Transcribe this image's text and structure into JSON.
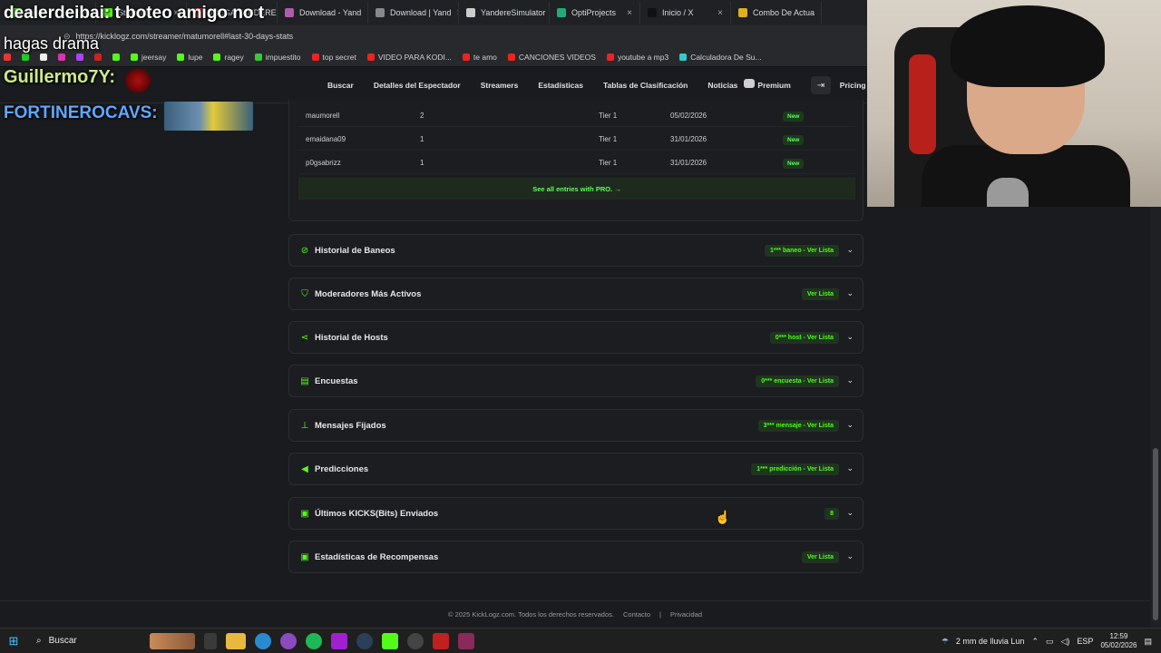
{
  "browser": {
    "tabs": [
      {
        "label": "Kick",
        "color": "#53fc18"
      },
      {
        "label": "Streamer",
        "color": "#53fc18"
      },
      {
        "label": "JUEGA YANDERE",
        "color": "#cc3333"
      },
      {
        "label": "Download - Yand",
        "color": "#b05ab0"
      },
      {
        "label": "Download | Yand",
        "color": "#888"
      },
      {
        "label": "YandereSimulator",
        "color": "#ccc"
      },
      {
        "label": "OptiProjects",
        "color": "#2a7"
      },
      {
        "label": "Inicio / X",
        "color": "#111"
      },
      {
        "label": "Combo De Actua",
        "color": "#e0b020"
      }
    ],
    "url": "https://kicklogz.com/streamer/matumorell#last-30-days-stats",
    "bookmarks": [
      {
        "label": "",
        "color": "#e33"
      },
      {
        "label": "",
        "color": "#2c2"
      },
      {
        "label": "",
        "color": "#eee"
      },
      {
        "label": "",
        "color": "#d3a"
      },
      {
        "label": "",
        "color": "#a4f"
      },
      {
        "label": "",
        "color": "#c22"
      },
      {
        "label": "",
        "color": "#53fc18"
      },
      {
        "label": "jeersay",
        "color": "#53fc18"
      },
      {
        "label": "lupe",
        "color": "#53fc18"
      },
      {
        "label": "ragey",
        "color": "#53fc18"
      },
      {
        "label": "impuestito",
        "color": "#3c3"
      },
      {
        "label": "top secret",
        "color": "#e22"
      },
      {
        "label": "VIDEO PARA KODI...",
        "color": "#e22"
      },
      {
        "label": "te amo",
        "color": "#e22"
      },
      {
        "label": "CANCIONES VIDEOS",
        "color": "#e22"
      },
      {
        "label": "youtube a mp3",
        "color": "#e22"
      },
      {
        "label": "Calculadora De Su...",
        "color": "#3cc"
      }
    ]
  },
  "overlay": {
    "chat_line1": "dealerdeibai: t boteo amigo no t",
    "chat_line2": "hagas drama",
    "user1": "Guillermo7Y:",
    "user2": "FORTINEROCAVS:"
  },
  "nav": {
    "links": [
      "Buscar",
      "Detalles del Espectador",
      "Streamers",
      "Estadísticas",
      "Tablas de Clasificación",
      "Noticias",
      "Premium"
    ],
    "pricing": "Pricing"
  },
  "table": {
    "rows": [
      {
        "user": "maumorell",
        "count": "2",
        "tier": "Tier 1",
        "date": "05/02/2026",
        "badge": "New"
      },
      {
        "user": "emaidana09",
        "count": "1",
        "tier": "Tier 1",
        "date": "31/01/2026",
        "badge": "New"
      },
      {
        "user": "p0gsabrizz",
        "count": "1",
        "tier": "Tier 1",
        "date": "31/01/2026",
        "badge": "New"
      }
    ],
    "pro_link": "See all entries with PRO. →"
  },
  "sections": [
    {
      "title": "Historial de Baneos",
      "pill": "1*** baneo - Ver Lista",
      "icon": "ban-icon"
    },
    {
      "title": "Moderadores Más Activos",
      "pill": "Ver Lista",
      "icon": "shield-icon"
    },
    {
      "title": "Historial de Hosts",
      "pill": "0*** host - Ver Lista",
      "icon": "share-icon"
    },
    {
      "title": "Encuestas",
      "pill": "0*** encuesta - Ver Lista",
      "icon": "poll-icon"
    },
    {
      "title": "Mensajes Fijados",
      "pill": "3*** mensaje - Ver Lista",
      "icon": "pin-icon"
    },
    {
      "title": "Predicciones",
      "pill": "1*** predicción - Ver Lista",
      "icon": "megaphone-icon"
    },
    {
      "title": "Últimos KICKS(Bits) Enviados",
      "pill": "8",
      "icon": "gift-icon"
    },
    {
      "title": "Estadísticas de Recompensas",
      "pill": "Ver Lista",
      "icon": "gift-icon"
    }
  ],
  "footer": {
    "copyright": "© 2025 KickLogz.com. Todos los derechos reservados.",
    "contact": "Contacto",
    "privacy": "Privacidad"
  },
  "taskbar": {
    "search": "Buscar",
    "weather": "2 mm de lluvia Lun",
    "lang": "ESP",
    "time": "12:59",
    "date": "05/02/2026"
  },
  "colors": {
    "accent": "#53fc18"
  }
}
